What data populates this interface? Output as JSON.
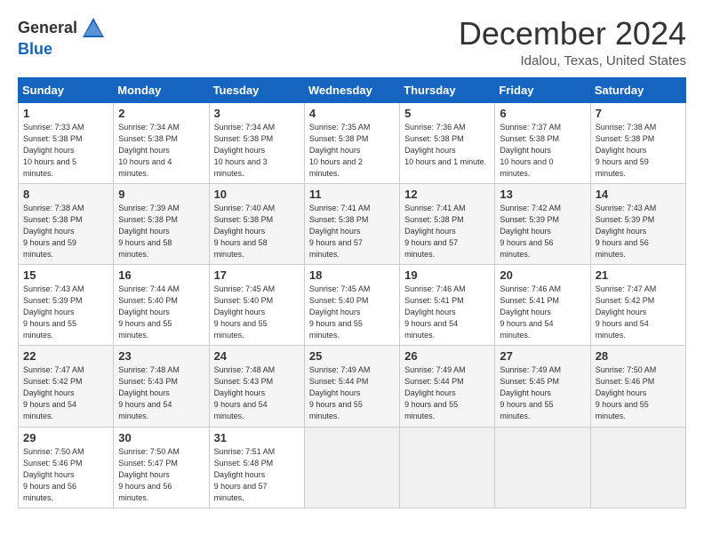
{
  "header": {
    "logo_general": "General",
    "logo_blue": "Blue",
    "month_title": "December 2024",
    "location": "Idalou, Texas, United States"
  },
  "weekdays": [
    "Sunday",
    "Monday",
    "Tuesday",
    "Wednesday",
    "Thursday",
    "Friday",
    "Saturday"
  ],
  "weeks": [
    [
      {
        "day": "1",
        "sunrise": "7:33 AM",
        "sunset": "5:38 PM",
        "daylight": "10 hours and 5 minutes."
      },
      {
        "day": "2",
        "sunrise": "7:34 AM",
        "sunset": "5:38 PM",
        "daylight": "10 hours and 4 minutes."
      },
      {
        "day": "3",
        "sunrise": "7:34 AM",
        "sunset": "5:38 PM",
        "daylight": "10 hours and 3 minutes."
      },
      {
        "day": "4",
        "sunrise": "7:35 AM",
        "sunset": "5:38 PM",
        "daylight": "10 hours and 2 minutes."
      },
      {
        "day": "5",
        "sunrise": "7:36 AM",
        "sunset": "5:38 PM",
        "daylight": "10 hours and 1 minute."
      },
      {
        "day": "6",
        "sunrise": "7:37 AM",
        "sunset": "5:38 PM",
        "daylight": "10 hours and 0 minutes."
      },
      {
        "day": "7",
        "sunrise": "7:38 AM",
        "sunset": "5:38 PM",
        "daylight": "9 hours and 59 minutes."
      }
    ],
    [
      {
        "day": "8",
        "sunrise": "7:38 AM",
        "sunset": "5:38 PM",
        "daylight": "9 hours and 59 minutes."
      },
      {
        "day": "9",
        "sunrise": "7:39 AM",
        "sunset": "5:38 PM",
        "daylight": "9 hours and 58 minutes."
      },
      {
        "day": "10",
        "sunrise": "7:40 AM",
        "sunset": "5:38 PM",
        "daylight": "9 hours and 58 minutes."
      },
      {
        "day": "11",
        "sunrise": "7:41 AM",
        "sunset": "5:38 PM",
        "daylight": "9 hours and 57 minutes."
      },
      {
        "day": "12",
        "sunrise": "7:41 AM",
        "sunset": "5:38 PM",
        "daylight": "9 hours and 57 minutes."
      },
      {
        "day": "13",
        "sunrise": "7:42 AM",
        "sunset": "5:39 PM",
        "daylight": "9 hours and 56 minutes."
      },
      {
        "day": "14",
        "sunrise": "7:43 AM",
        "sunset": "5:39 PM",
        "daylight": "9 hours and 56 minutes."
      }
    ],
    [
      {
        "day": "15",
        "sunrise": "7:43 AM",
        "sunset": "5:39 PM",
        "daylight": "9 hours and 55 minutes."
      },
      {
        "day": "16",
        "sunrise": "7:44 AM",
        "sunset": "5:40 PM",
        "daylight": "9 hours and 55 minutes."
      },
      {
        "day": "17",
        "sunrise": "7:45 AM",
        "sunset": "5:40 PM",
        "daylight": "9 hours and 55 minutes."
      },
      {
        "day": "18",
        "sunrise": "7:45 AM",
        "sunset": "5:40 PM",
        "daylight": "9 hours and 55 minutes."
      },
      {
        "day": "19",
        "sunrise": "7:46 AM",
        "sunset": "5:41 PM",
        "daylight": "9 hours and 54 minutes."
      },
      {
        "day": "20",
        "sunrise": "7:46 AM",
        "sunset": "5:41 PM",
        "daylight": "9 hours and 54 minutes."
      },
      {
        "day": "21",
        "sunrise": "7:47 AM",
        "sunset": "5:42 PM",
        "daylight": "9 hours and 54 minutes."
      }
    ],
    [
      {
        "day": "22",
        "sunrise": "7:47 AM",
        "sunset": "5:42 PM",
        "daylight": "9 hours and 54 minutes."
      },
      {
        "day": "23",
        "sunrise": "7:48 AM",
        "sunset": "5:43 PM",
        "daylight": "9 hours and 54 minutes."
      },
      {
        "day": "24",
        "sunrise": "7:48 AM",
        "sunset": "5:43 PM",
        "daylight": "9 hours and 54 minutes."
      },
      {
        "day": "25",
        "sunrise": "7:49 AM",
        "sunset": "5:44 PM",
        "daylight": "9 hours and 55 minutes."
      },
      {
        "day": "26",
        "sunrise": "7:49 AM",
        "sunset": "5:44 PM",
        "daylight": "9 hours and 55 minutes."
      },
      {
        "day": "27",
        "sunrise": "7:49 AM",
        "sunset": "5:45 PM",
        "daylight": "9 hours and 55 minutes."
      },
      {
        "day": "28",
        "sunrise": "7:50 AM",
        "sunset": "5:46 PM",
        "daylight": "9 hours and 55 minutes."
      }
    ],
    [
      {
        "day": "29",
        "sunrise": "7:50 AM",
        "sunset": "5:46 PM",
        "daylight": "9 hours and 56 minutes."
      },
      {
        "day": "30",
        "sunrise": "7:50 AM",
        "sunset": "5:47 PM",
        "daylight": "9 hours and 56 minutes."
      },
      {
        "day": "31",
        "sunrise": "7:51 AM",
        "sunset": "5:48 PM",
        "daylight": "9 hours and 57 minutes."
      },
      null,
      null,
      null,
      null
    ]
  ]
}
